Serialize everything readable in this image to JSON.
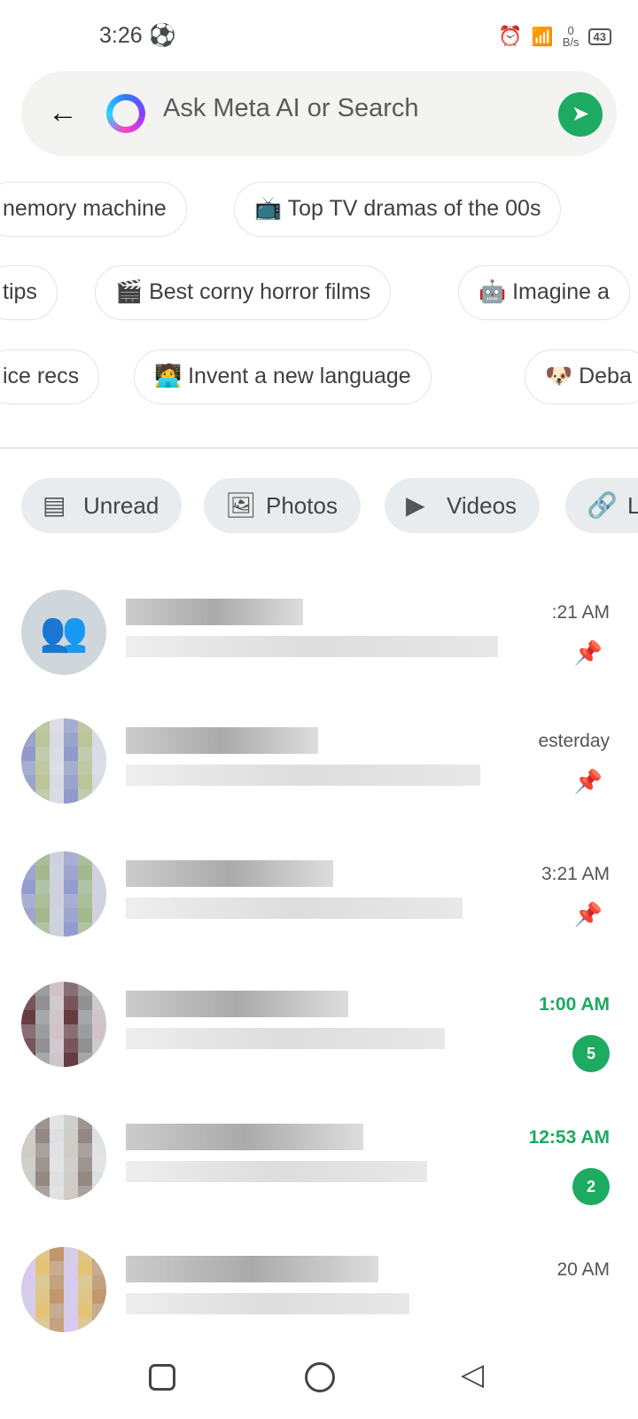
{
  "status_bar": {
    "time": "3:26",
    "net_speed_value": "0",
    "net_speed_unit": "B/s",
    "battery": "43"
  },
  "search": {
    "placeholder": "Ask Meta AI or Search"
  },
  "suggestions": [
    [
      {
        "emoji": "",
        "label": "nemory machine"
      },
      {
        "emoji": "📺",
        "label": "Top TV dramas of the 00s"
      }
    ],
    [
      {
        "emoji": "",
        "label": "tips"
      },
      {
        "emoji": "🎬",
        "label": "Best corny horror films"
      },
      {
        "emoji": "🤖",
        "label": "Imagine a"
      }
    ],
    [
      {
        "emoji": "",
        "label": "ice recs"
      },
      {
        "emoji": "🧑‍💻",
        "label": "Invent a new language"
      },
      {
        "emoji": "🐶",
        "label": "Deba"
      }
    ]
  ],
  "filters": [
    {
      "label": "Unread",
      "icon": "unread-icon"
    },
    {
      "label": "Photos",
      "icon": "image-icon"
    },
    {
      "label": "Videos",
      "icon": "video-icon"
    },
    {
      "label": "L",
      "icon": "link-icon"
    }
  ],
  "chats": [
    {
      "time": ":21 AM",
      "pinned": true,
      "unread": null,
      "group": true
    },
    {
      "time": "esterday",
      "pinned": true,
      "unread": null
    },
    {
      "time": "3:21 AM",
      "pinned": true,
      "unread": null
    },
    {
      "time": "1:00 AM",
      "pinned": false,
      "unread": "5"
    },
    {
      "time": "12:53 AM",
      "pinned": false,
      "unread": "2"
    },
    {
      "time": "20 AM",
      "pinned": false,
      "unread": null
    }
  ],
  "colors": {
    "accent": "#1daa61"
  }
}
